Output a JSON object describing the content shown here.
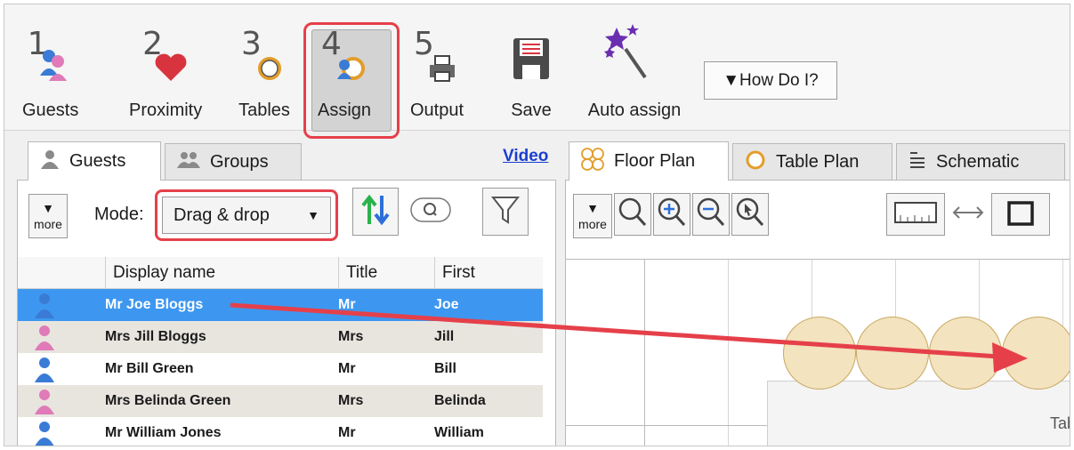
{
  "ribbon": {
    "buttons": [
      {
        "num": "1",
        "label": "Guests"
      },
      {
        "num": "2",
        "label": "Proximity"
      },
      {
        "num": "3",
        "label": "Tables"
      },
      {
        "num": "4",
        "label": "Assign"
      },
      {
        "num": "5",
        "label": "Output"
      },
      {
        "num": "",
        "label": "Save"
      },
      {
        "num": "",
        "label": "Auto assign"
      }
    ],
    "how_do_i": "▼How Do I?"
  },
  "left": {
    "tabs": [
      "Guests",
      "Groups"
    ],
    "video_link": "Video",
    "more_label": "more",
    "mode_label": "Mode:",
    "mode_value": "Drag & drop",
    "columns": [
      "Display name",
      "Title",
      "First"
    ],
    "rows": [
      {
        "display": "Mr Joe Bloggs",
        "title": "Mr",
        "first": "Joe",
        "gender": "male"
      },
      {
        "display": "Mrs Jill Bloggs",
        "title": "Mrs",
        "first": "Jill",
        "gender": "female"
      },
      {
        "display": "Mr Bill Green",
        "title": "Mr",
        "first": "Bill",
        "gender": "male"
      },
      {
        "display": "Mrs Belinda Green",
        "title": "Mrs",
        "first": "Belinda",
        "gender": "female"
      },
      {
        "display": "Mr William Jones",
        "title": "Mr",
        "first": "William",
        "gender": "male"
      }
    ]
  },
  "right": {
    "tabs": [
      "Floor Plan",
      "Table Plan",
      "Schematic"
    ],
    "more_label": "more",
    "canvas_label": "Tab"
  },
  "colors": {
    "accent_red": "#e5404a",
    "selection_blue": "#3d97f0",
    "male_icon": "#3a7bd5",
    "female_icon": "#e07ab8",
    "seat_fill": "#f3e3bf"
  }
}
